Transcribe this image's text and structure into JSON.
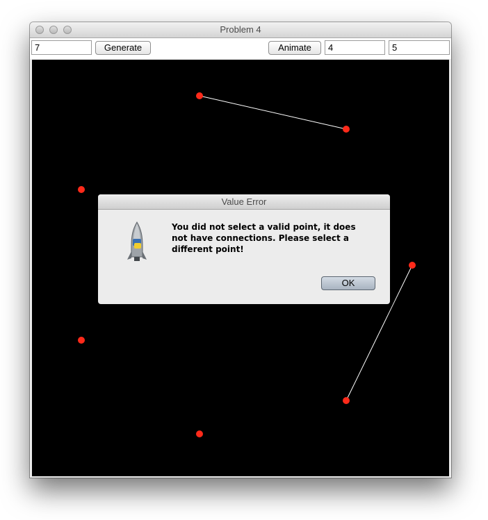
{
  "window": {
    "title": "Problem 4"
  },
  "toolbar": {
    "count_value": "7",
    "generate_label": "Generate",
    "animate_label": "Animate",
    "from_value": "4",
    "to_value": "5"
  },
  "dialog": {
    "title": "Value Error",
    "message": "You did not select a valid point, it does not have connections. Please select a different point!",
    "ok_label": "OK"
  },
  "colors": {
    "point": "#ff2a1a",
    "edge": "#ffffff",
    "canvas": "#000000"
  },
  "icons": [
    "close-icon",
    "minimize-icon",
    "zoom-icon",
    "python-launcher-icon"
  ]
}
